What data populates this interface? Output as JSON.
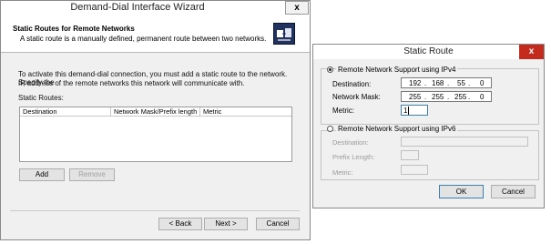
{
  "wizard": {
    "title": "Demand-Dial Interface Wizard",
    "close_label": "x",
    "header_title": "Static Routes for Remote Networks",
    "header_subtitle": "A static route is a manually defined, permanent route between two networks.",
    "body_line1": "To activate this demand-dial connection, you must add a static route to the network. Specify the",
    "body_line2": "IP address of the remote networks this network will communicate with.",
    "routes_label": "Static Routes:",
    "columns": [
      "Destination",
      "Network Mask/Prefix length",
      "Metric"
    ],
    "add_label": "Add",
    "remove_label": "Remove",
    "back_label": "< Back",
    "next_label": "Next >",
    "cancel_label": "Cancel"
  },
  "static_route": {
    "title": "Static Route",
    "close_label": "x",
    "ipv4_label": "Remote Network Support using IPv4",
    "ipv4_selected": true,
    "destination_label": "Destination:",
    "destination_octets": [
      "192",
      "168",
      "55",
      "0"
    ],
    "mask_label": "Network Mask:",
    "mask_octets": [
      "255",
      "255",
      "255",
      "0"
    ],
    "metric_label": "Metric:",
    "metric_value": "1",
    "ipv6_label": "Remote Network Support using IPv6",
    "ipv6_destination_label": "Destination:",
    "prefix_length_label": "Prefix Length:",
    "ipv6_metric_label": "Metric:",
    "ok_label": "OK",
    "cancel_label": "Cancel"
  },
  "colors": {
    "close_red": "#c42b1c",
    "icon_navy": "#22325f"
  }
}
